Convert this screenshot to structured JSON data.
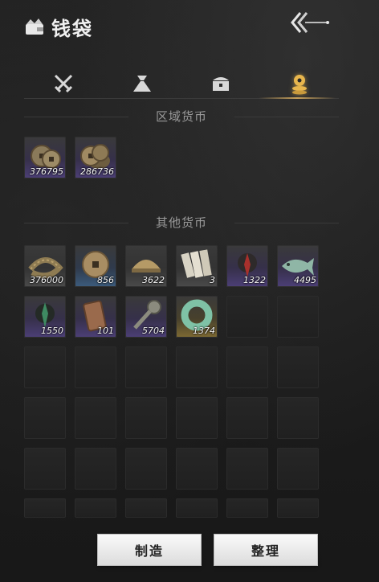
{
  "header": {
    "title": "钱袋",
    "title_icon": "wallet-icon",
    "back_icon": "back-arrow-icon"
  },
  "tabs": [
    {
      "icon": "crossed-swords-icon",
      "active": false
    },
    {
      "icon": "pouch-icon",
      "active": false
    },
    {
      "icon": "chest-icon",
      "active": false
    },
    {
      "icon": "coin-stack-icon",
      "active": true
    }
  ],
  "colors": {
    "accent": "#e8b64d",
    "quality_purple": "#4c3f77",
    "quality_blue": "#3c5c7d",
    "quality_gold": "#7e6a33"
  },
  "regional": {
    "title": "区域货币",
    "items": [
      {
        "icon": "copper-coins-icon",
        "qty": "376795",
        "quality": "purple"
      },
      {
        "icon": "copper-coin-stack-icon",
        "qty": "286736",
        "quality": "purple"
      }
    ]
  },
  "other": {
    "title": "其他货币",
    "items": [
      {
        "icon": "coin-string-icon",
        "qty": "376000",
        "quality": "gray"
      },
      {
        "icon": "square-hole-coin-icon",
        "qty": "856",
        "quality": "blue"
      },
      {
        "icon": "silver-ingot-icon",
        "qty": "3622",
        "quality": "gray"
      },
      {
        "icon": "paper-notes-icon",
        "qty": "3",
        "quality": "gray"
      },
      {
        "icon": "red-feather-token-icon",
        "qty": "1322",
        "quality": "purple"
      },
      {
        "icon": "jade-fish-icon",
        "qty": "4495",
        "quality": "purple"
      },
      {
        "icon": "green-feather-token-icon",
        "qty": "1550",
        "quality": "purple"
      },
      {
        "icon": "bronze-plaque-icon",
        "qty": "101",
        "quality": "purple"
      },
      {
        "icon": "key-coin-icon",
        "qty": "5704",
        "quality": "purple"
      },
      {
        "icon": "jade-ring-icon",
        "qty": "1374",
        "quality": "gold"
      }
    ]
  },
  "buttons": {
    "craft": "制造",
    "organize": "整理"
  }
}
